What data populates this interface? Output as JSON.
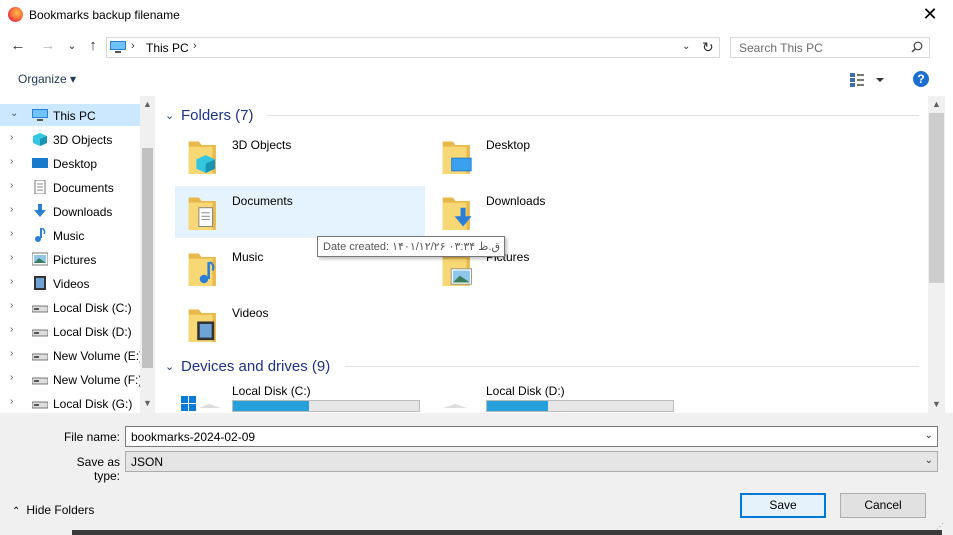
{
  "window": {
    "title": "Bookmarks backup filename",
    "close": "✕"
  },
  "nav": {
    "back": "←",
    "forward": "→",
    "recent": "⌄",
    "up": "↑",
    "address": {
      "crumb": "This PC",
      "sep": "›",
      "dropdown": "⌄",
      "refresh": "↻"
    },
    "search_placeholder": "Search This PC"
  },
  "toolbar": {
    "organize": "Organize ▾",
    "help": "?"
  },
  "sidebar": {
    "items": [
      {
        "label": "This PC",
        "icon": "computer-icon",
        "selected": true,
        "chevron": "⌄"
      },
      {
        "label": "3D Objects",
        "icon": "cube-icon",
        "chevron": "›"
      },
      {
        "label": "Desktop",
        "icon": "desktop-icon",
        "chevron": "›"
      },
      {
        "label": "Documents",
        "icon": "document-icon",
        "chevron": "›"
      },
      {
        "label": "Downloads",
        "icon": "download-icon",
        "chevron": "›"
      },
      {
        "label": "Music",
        "icon": "music-icon",
        "chevron": "›"
      },
      {
        "label": "Pictures",
        "icon": "picture-icon",
        "chevron": "›"
      },
      {
        "label": "Videos",
        "icon": "video-icon",
        "chevron": "›"
      },
      {
        "label": "Local Disk (C:)",
        "icon": "drive-icon",
        "chevron": "›"
      },
      {
        "label": "Local Disk (D:)",
        "icon": "drive-icon",
        "chevron": "›"
      },
      {
        "label": "New Volume (E:)",
        "icon": "drive-icon",
        "chevron": "›"
      },
      {
        "label": "New Volume (F:)",
        "icon": "drive-icon",
        "chevron": "›"
      },
      {
        "label": "Local Disk (G:)",
        "icon": "drive-icon",
        "chevron": "›"
      }
    ]
  },
  "content": {
    "folders_header": "Folders (7)",
    "folders": [
      {
        "name": "3D Objects",
        "icon": "cube-icon"
      },
      {
        "name": "Desktop",
        "icon": "desktop-icon"
      },
      {
        "name": "Documents",
        "icon": "document-icon",
        "hover": true
      },
      {
        "name": "Downloads",
        "icon": "download-icon"
      },
      {
        "name": "Music",
        "icon": "music-icon"
      },
      {
        "name": "Pictures",
        "icon": "picture-icon"
      },
      {
        "name": "Videos",
        "icon": "video-icon"
      }
    ],
    "devices_header": "Devices and drives (9)",
    "drives": [
      {
        "name": "Local Disk (C:)",
        "used_fraction": 0.41
      },
      {
        "name": "Local Disk (D:)",
        "used_fraction": 0.33
      }
    ],
    "tooltip": "Date created: ۱۴۰۱/۱۲/۲۶ ق.ظ ۰۳:۳۴"
  },
  "form": {
    "filename_label": "File name:",
    "filename_value": "bookmarks-2024-02-09",
    "savetype_label": "Save as type:",
    "savetype_value": "JSON",
    "dropdown": "⌄"
  },
  "footer": {
    "hide_folders": "Hide Folders",
    "chevron": "⌃",
    "save": "Save",
    "cancel": "Cancel"
  },
  "colors": {
    "accent": "#0078d7",
    "selection": "#cce8ff",
    "hover": "#e5f3ff",
    "folder": "#f8d775",
    "header": "#1e3287"
  }
}
